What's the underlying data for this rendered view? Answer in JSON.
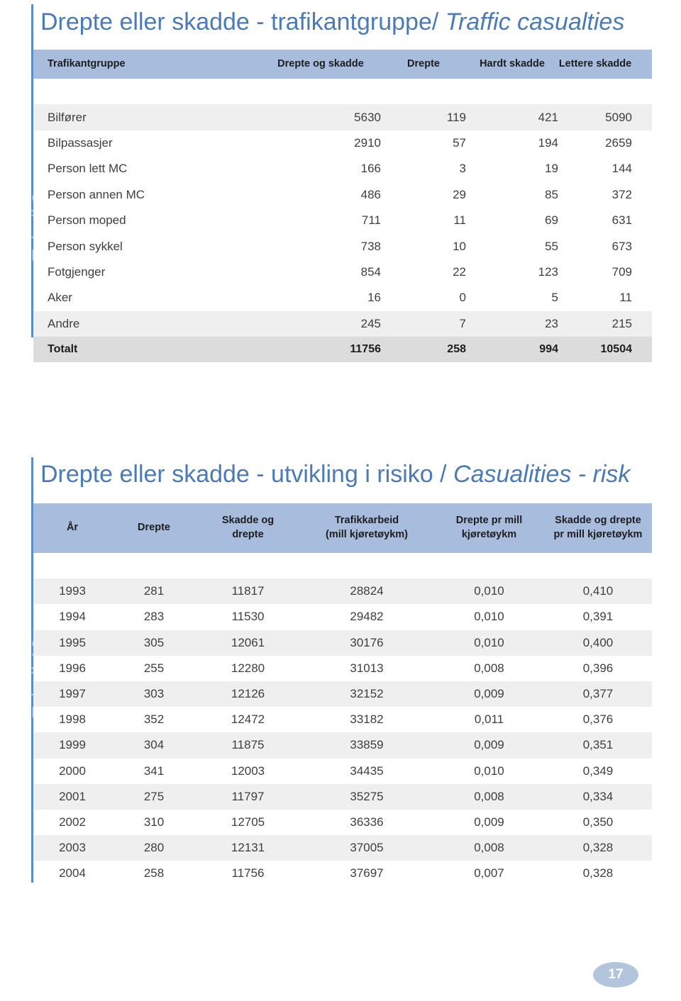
{
  "page": {
    "number": "17",
    "accent_blue": "#4a7ab8",
    "header_bg": "#a8bcdd",
    "rule_color": "#5b8ec4",
    "side_label_color": "#aec3e0"
  },
  "table9": {
    "side_label": "Tabell 9",
    "title_no": "Drepte eller skadde - trafikantgruppe/",
    "title_en": "Traffic casualties",
    "columns": [
      "Trafikantgruppe",
      "Drepte og skadde",
      "Drepte",
      "Hardt skadde",
      "Lettere skadde"
    ],
    "rows": [
      {
        "group": "Bilfører",
        "drepte_og_skadde": "5630",
        "drepte": "119",
        "hardt_skadde": "421",
        "lettere_skadde": "5090"
      },
      {
        "group": "Bilpassasjer",
        "drepte_og_skadde": "2910",
        "drepte": "57",
        "hardt_skadde": "194",
        "lettere_skadde": "2659"
      },
      {
        "group": "Person lett MC",
        "drepte_og_skadde": "166",
        "drepte": "3",
        "hardt_skadde": "19",
        "lettere_skadde": "144"
      },
      {
        "group": "Person annen MC",
        "drepte_og_skadde": "486",
        "drepte": "29",
        "hardt_skadde": "85",
        "lettere_skadde": "372"
      },
      {
        "group": "Person moped",
        "drepte_og_skadde": "711",
        "drepte": "11",
        "hardt_skadde": "69",
        "lettere_skadde": "631"
      },
      {
        "group": "Person sykkel",
        "drepte_og_skadde": "738",
        "drepte": "10",
        "hardt_skadde": "55",
        "lettere_skadde": "673"
      },
      {
        "group": "Fotgjenger",
        "drepte_og_skadde": "854",
        "drepte": "22",
        "hardt_skadde": "123",
        "lettere_skadde": "709"
      },
      {
        "group": "Aker",
        "drepte_og_skadde": "16",
        "drepte": "0",
        "hardt_skadde": "5",
        "lettere_skadde": "11"
      },
      {
        "group": "Andre",
        "drepte_og_skadde": "245",
        "drepte": "7",
        "hardt_skadde": "23",
        "lettere_skadde": "215"
      }
    ],
    "total": {
      "group": "Totalt",
      "drepte_og_skadde": "11756",
      "drepte": "258",
      "hardt_skadde": "994",
      "lettere_skadde": "10504"
    }
  },
  "table10": {
    "side_label": "Tabell 10",
    "title_no": "Drepte eller skadde - utvikling i risiko /",
    "title_en": "Casualities - risk",
    "columns": [
      "År",
      "Drepte",
      "Skadde og drepte",
      "Trafikkarbeid (mill kjøretøykm)",
      "Drepte pr mill kjøretøykm",
      "Skadde og drepte pr mill kjøretøykm"
    ],
    "columns_lines": [
      [
        "År"
      ],
      [
        "Drepte"
      ],
      [
        "Skadde og",
        "drepte"
      ],
      [
        "Trafikkarbeid",
        "(mill kjøretøykm)"
      ],
      [
        "Drepte pr mill",
        "kjøretøykm"
      ],
      [
        "Skadde og drepte",
        "pr mill kjøretøykm"
      ]
    ],
    "rows": [
      {
        "ar": "1993",
        "drepte": "281",
        "skadde_og_drepte": "11817",
        "trafikkarbeid": "28824",
        "drepte_pr_mill": "0,010",
        "skadde_drepte_pr_mill": "0,410"
      },
      {
        "ar": "1994",
        "drepte": "283",
        "skadde_og_drepte": "11530",
        "trafikkarbeid": "29482",
        "drepte_pr_mill": "0,010",
        "skadde_drepte_pr_mill": "0,391"
      },
      {
        "ar": "1995",
        "drepte": "305",
        "skadde_og_drepte": "12061",
        "trafikkarbeid": "30176",
        "drepte_pr_mill": "0,010",
        "skadde_drepte_pr_mill": "0,400"
      },
      {
        "ar": "1996",
        "drepte": "255",
        "skadde_og_drepte": "12280",
        "trafikkarbeid": "31013",
        "drepte_pr_mill": "0,008",
        "skadde_drepte_pr_mill": "0,396"
      },
      {
        "ar": "1997",
        "drepte": "303",
        "skadde_og_drepte": "12126",
        "trafikkarbeid": "32152",
        "drepte_pr_mill": "0,009",
        "skadde_drepte_pr_mill": "0,377"
      },
      {
        "ar": "1998",
        "drepte": "352",
        "skadde_og_drepte": "12472",
        "trafikkarbeid": "33182",
        "drepte_pr_mill": "0,011",
        "skadde_drepte_pr_mill": "0,376"
      },
      {
        "ar": "1999",
        "drepte": "304",
        "skadde_og_drepte": "11875",
        "trafikkarbeid": "33859",
        "drepte_pr_mill": "0,009",
        "skadde_drepte_pr_mill": "0,351"
      },
      {
        "ar": "2000",
        "drepte": "341",
        "skadde_og_drepte": "12003",
        "trafikkarbeid": "34435",
        "drepte_pr_mill": "0,010",
        "skadde_drepte_pr_mill": "0,349"
      },
      {
        "ar": "2001",
        "drepte": "275",
        "skadde_og_drepte": "11797",
        "trafikkarbeid": "35275",
        "drepte_pr_mill": "0,008",
        "skadde_drepte_pr_mill": "0,334"
      },
      {
        "ar": "2002",
        "drepte": "310",
        "skadde_og_drepte": "12705",
        "trafikkarbeid": "36336",
        "drepte_pr_mill": "0,009",
        "skadde_drepte_pr_mill": "0,350"
      },
      {
        "ar": "2003",
        "drepte": "280",
        "skadde_og_drepte": "12131",
        "trafikkarbeid": "37005",
        "drepte_pr_mill": "0,008",
        "skadde_drepte_pr_mill": "0,328"
      },
      {
        "ar": "2004",
        "drepte": "258",
        "skadde_og_drepte": "11756",
        "trafikkarbeid": "37697",
        "drepte_pr_mill": "0,007",
        "skadde_drepte_pr_mill": "0,328"
      }
    ]
  },
  "chart_data": [
    {
      "type": "table",
      "title": "Drepte eller skadde - trafikantgruppe/ Traffic casualties",
      "columns": [
        "Trafikantgruppe",
        "Drepte og skadde",
        "Drepte",
        "Hardt skadde",
        "Lettere skadde"
      ],
      "categories": [
        "Bilfører",
        "Bilpassasjer",
        "Person lett MC",
        "Person annen MC",
        "Person moped",
        "Person sykkel",
        "Fotgjenger",
        "Aker",
        "Andre",
        "Totalt"
      ],
      "series": [
        {
          "name": "Drepte og skadde",
          "values": [
            5630,
            2910,
            166,
            486,
            711,
            738,
            854,
            16,
            245,
            11756
          ]
        },
        {
          "name": "Drepte",
          "values": [
            119,
            57,
            3,
            29,
            11,
            10,
            22,
            0,
            7,
            258
          ]
        },
        {
          "name": "Hardt skadde",
          "values": [
            421,
            194,
            19,
            85,
            69,
            55,
            123,
            5,
            23,
            994
          ]
        },
        {
          "name": "Lettere skadde",
          "values": [
            5090,
            2659,
            144,
            372,
            631,
            673,
            709,
            11,
            215,
            10504
          ]
        }
      ]
    },
    {
      "type": "table",
      "title": "Drepte eller skadde - utvikling i risiko / Casualities - risk",
      "columns": [
        "År",
        "Drepte",
        "Skadde og drepte",
        "Trafikkarbeid (mill kjøretøykm)",
        "Drepte pr mill kjøretøykm",
        "Skadde og drepte pr mill kjøretøykm"
      ],
      "x": [
        1993,
        1994,
        1995,
        1996,
        1997,
        1998,
        1999,
        2000,
        2001,
        2002,
        2003,
        2004
      ],
      "xlabel": "År",
      "series": [
        {
          "name": "Drepte",
          "values": [
            281,
            283,
            305,
            255,
            303,
            352,
            304,
            341,
            275,
            310,
            280,
            258
          ]
        },
        {
          "name": "Skadde og drepte",
          "values": [
            11817,
            11530,
            12061,
            12280,
            12126,
            12472,
            11875,
            12003,
            11797,
            12705,
            12131,
            11756
          ]
        },
        {
          "name": "Trafikkarbeid (mill kjøretøykm)",
          "values": [
            28824,
            29482,
            30176,
            31013,
            32152,
            33182,
            33859,
            34435,
            35275,
            36336,
            37005,
            37697
          ]
        },
        {
          "name": "Drepte pr mill kjøretøykm",
          "values": [
            0.01,
            0.01,
            0.01,
            0.008,
            0.009,
            0.011,
            0.009,
            0.01,
            0.008,
            0.009,
            0.008,
            0.007
          ]
        },
        {
          "name": "Skadde og drepte pr mill kjøretøykm",
          "values": [
            0.41,
            0.391,
            0.4,
            0.396,
            0.377,
            0.376,
            0.351,
            0.349,
            0.334,
            0.35,
            0.328,
            0.328
          ]
        }
      ]
    }
  ]
}
